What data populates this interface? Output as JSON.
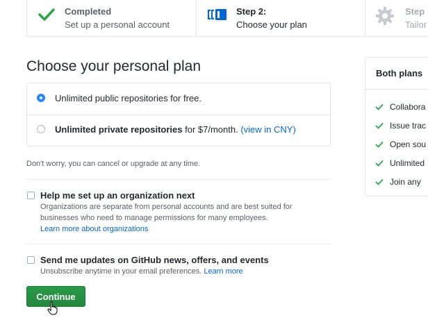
{
  "steps": [
    {
      "title": "Completed",
      "subtitle": "Set up a personal account"
    },
    {
      "title": "Step 2:",
      "subtitle": "Choose your plan"
    },
    {
      "title": "Step",
      "subtitle": "Tailor"
    }
  ],
  "heading": "Choose your personal plan",
  "plans": {
    "free": {
      "text": "Unlimited public repositories for free.",
      "selected": true
    },
    "paid": {
      "bold": "Unlimited private repositories",
      "text": " for $7/month. ",
      "link": "(view in CNY)",
      "selected": false
    }
  },
  "note": "Don't worry, you can cancel or upgrade at any time.",
  "options": {
    "org": {
      "title": "Help me set up an organization next",
      "desc1": "Organizations are separate from personal accounts and are best suited for",
      "desc2": "businesses who need to manage permissions for many employees.",
      "link": "Learn more about organizations",
      "checked": false
    },
    "updates": {
      "title": "Send me updates on GitHub news, offers, and events",
      "desc": "Unsubscribe anytime in your email preferences. ",
      "link": "Learn more",
      "checked": false
    }
  },
  "continue_label": "Continue",
  "side": {
    "heading": "Both plans",
    "items": [
      "Collabora",
      "Issue trac",
      "Open sou",
      "Unlimited",
      "Join any"
    ]
  },
  "colors": {
    "accent": "#0366d6",
    "primary_button": "#28a745",
    "check": "#28a745"
  },
  "icons": [
    "check-icon",
    "browser-icon",
    "gear-icon",
    "pointer-cursor-icon"
  ]
}
